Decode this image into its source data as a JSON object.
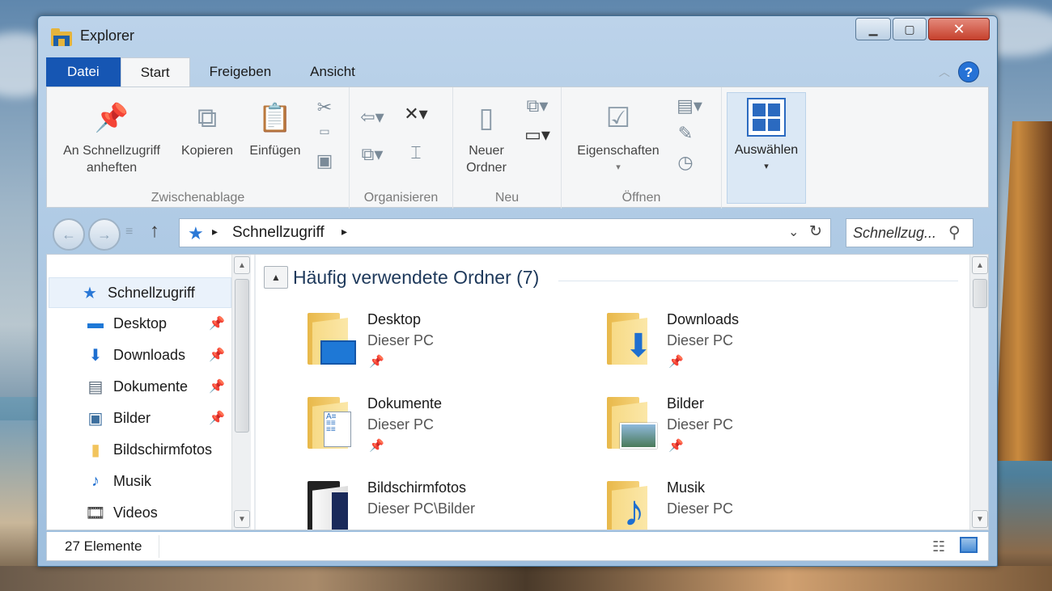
{
  "window": {
    "title": "Explorer"
  },
  "tabs": [
    {
      "label": "Datei"
    },
    {
      "label": "Start"
    },
    {
      "label": "Freigeben"
    },
    {
      "label": "Ansicht"
    }
  ],
  "ribbon": {
    "clipboard": {
      "pin_label_1": "An Schnellzugriff",
      "pin_label_2": "anheften",
      "copy_label": "Kopieren",
      "paste_label": "Einfügen",
      "group_label": "Zwischenablage"
    },
    "organize": {
      "group_label": "Organisieren"
    },
    "new": {
      "folder_label_1": "Neuer",
      "folder_label_2": "Ordner",
      "group_label": "Neu"
    },
    "open": {
      "properties_label": "Eigenschaften",
      "group_label": "Öffnen"
    },
    "select": {
      "label": "Auswählen"
    }
  },
  "address": {
    "path": "Schnellzugriff",
    "search_placeholder": "Schnellzug..."
  },
  "nav_pane": {
    "items": [
      {
        "label": "Schnellzugriff",
        "icon": "star-icon",
        "pinned": false
      },
      {
        "label": "Desktop",
        "icon": "desktop-icon",
        "pinned": true
      },
      {
        "label": "Downloads",
        "icon": "download-icon",
        "pinned": true
      },
      {
        "label": "Dokumente",
        "icon": "document-icon",
        "pinned": true
      },
      {
        "label": "Bilder",
        "icon": "picture-icon",
        "pinned": true
      },
      {
        "label": "Bildschirmfotos",
        "icon": "folder-icon",
        "pinned": false
      },
      {
        "label": "Musik",
        "icon": "music-icon",
        "pinned": false
      },
      {
        "label": "Videos",
        "icon": "video-icon",
        "pinned": false
      }
    ]
  },
  "main": {
    "section_title": "Häufig verwendete Ordner (7)",
    "folders": [
      {
        "name": "Desktop",
        "location": "Dieser PC",
        "pinned": true
      },
      {
        "name": "Downloads",
        "location": "Dieser PC",
        "pinned": true
      },
      {
        "name": "Dokumente",
        "location": "Dieser PC",
        "pinned": true
      },
      {
        "name": "Bilder",
        "location": "Dieser PC",
        "pinned": true
      },
      {
        "name": "Bildschirmfotos",
        "location": "Dieser PC\\Bilder",
        "pinned": false
      },
      {
        "name": "Musik",
        "location": "Dieser PC",
        "pinned": false
      }
    ]
  },
  "status": {
    "count": "27 Elemente"
  },
  "colors": {
    "accent": "#1656b3",
    "folder": "#f5d27a",
    "star": "#2a78d6"
  }
}
